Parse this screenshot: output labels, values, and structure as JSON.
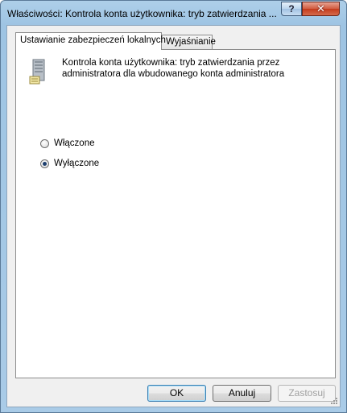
{
  "window": {
    "title": "Właściwości: Kontrola konta użytkownika: tryb zatwierdzania ...",
    "help_glyph": "?",
    "close_glyph": "✕"
  },
  "tabs": [
    {
      "label": "Ustawianie zabezpieczeń lokalnych",
      "active": true
    },
    {
      "label": "Wyjaśnianie",
      "active": false
    }
  ],
  "policy": {
    "icon": "server-icon",
    "description": "Kontrola konta użytkownika: tryb zatwierdzania przez administratora dla wbudowanego konta administratora"
  },
  "options": [
    {
      "label": "Włączone",
      "checked": false
    },
    {
      "label": "Wyłączone",
      "checked": true
    }
  ],
  "buttons": {
    "ok": "OK",
    "cancel": "Anuluj",
    "apply": "Zastosuj",
    "apply_enabled": false
  },
  "colors": {
    "frame": "#a9cbe7",
    "close": "#c43b1c",
    "dialog_bg": "#f0f0f0"
  }
}
